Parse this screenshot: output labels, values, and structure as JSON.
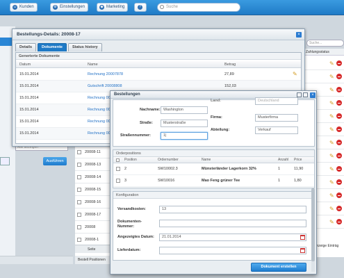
{
  "toolbar": {
    "buttons": [
      {
        "label": "Kunden",
        "icon": "users-icon"
      },
      {
        "label": "Einstellungen",
        "icon": "gear-icon"
      },
      {
        "label": "Marketing",
        "icon": "megaphone-icon"
      },
      {
        "label": "",
        "icon": "help-icon"
      }
    ],
    "search_placeholder": "Suche"
  },
  "background": {
    "right_search_placeholder": "Suche...",
    "right_header": "Zahlungsstatus",
    "right_footer": "Anzeige Einträg",
    "select_placeholder": "Alle anzeigen",
    "apply_button": "Ausführen",
    "order_numbers": [
      "20008-11",
      "20008-13",
      "20008-14",
      "20008-15",
      "20008-16",
      "20008-17",
      "20008",
      "20008-1"
    ],
    "paging_label": "Seite",
    "positions_label": "Bestell Positionen"
  },
  "details_window": {
    "title": "Bestellungs-Details: 20008-17",
    "tabs": [
      "Details",
      "Dokumente",
      "Status history"
    ],
    "active_tab": 1,
    "section_title": "Generierte Dokumente",
    "columns": [
      "Datum",
      "Name",
      "Betrag"
    ],
    "rows": [
      {
        "date": "15.01.2014",
        "name": "Rechnung 20007878",
        "amount": "27,89"
      },
      {
        "date": "15.01.2014",
        "name": "Gutschrift 20008808",
        "amount": "152,03"
      },
      {
        "date": "15.01.2014",
        "name": "Rechnung 0000",
        "amount": ""
      },
      {
        "date": "15.01.2014",
        "name": "Rechnung 0000",
        "amount": ""
      },
      {
        "date": "15.01.2014",
        "name": "Rechnung 0000",
        "amount": ""
      },
      {
        "date": "15.01.2014",
        "name": "Rechnung 0000",
        "amount": ""
      }
    ]
  },
  "orders_window": {
    "title": "Bestellungen",
    "fields_left": [
      {
        "label": "Nachname:",
        "value": "Washington"
      },
      {
        "label": "Straße:",
        "value": "Musterstraße"
      },
      {
        "label": "Straßennummer:",
        "value": "1|"
      }
    ],
    "fields_right": [
      {
        "label": "Land:",
        "value": "Deutschland"
      },
      {
        "label": "Firma:",
        "value": "Musterfirma"
      },
      {
        "label": "Abteilung:",
        "value": "Verkauf"
      }
    ],
    "positions_title": "Orderpositions",
    "positions_columns": [
      "Position",
      "Ordernumber",
      "Name",
      "Anzahl",
      "Price"
    ],
    "positions": [
      {
        "pos": "2",
        "number": "SW10002.3",
        "name": "Münsterländer Lagerkorn 32%",
        "qty": "1",
        "price": "11,90"
      },
      {
        "pos": "3",
        "number": "SW10016",
        "name": "Mao Feng grüner Tee",
        "qty": "1",
        "price": "1,80"
      }
    ],
    "config_title": "Konfiguration",
    "config": {
      "shipping_label": "Versandkosten:",
      "shipping_value": "13",
      "doc_number_label": "Dokumenten-Nummer:",
      "doc_number_value": "",
      "display_date_label": "Angezeigtes Datum:",
      "display_date_value": "21.01.2014",
      "delivery_date_label": "Lieferdatum:",
      "delivery_date_value": ""
    },
    "create_button": "Dokument erstellen"
  },
  "colors": {
    "accent": "#1f7ac6",
    "link": "#1f6fc5",
    "delete": "#d62a2a",
    "edit": "#d39a1e"
  }
}
